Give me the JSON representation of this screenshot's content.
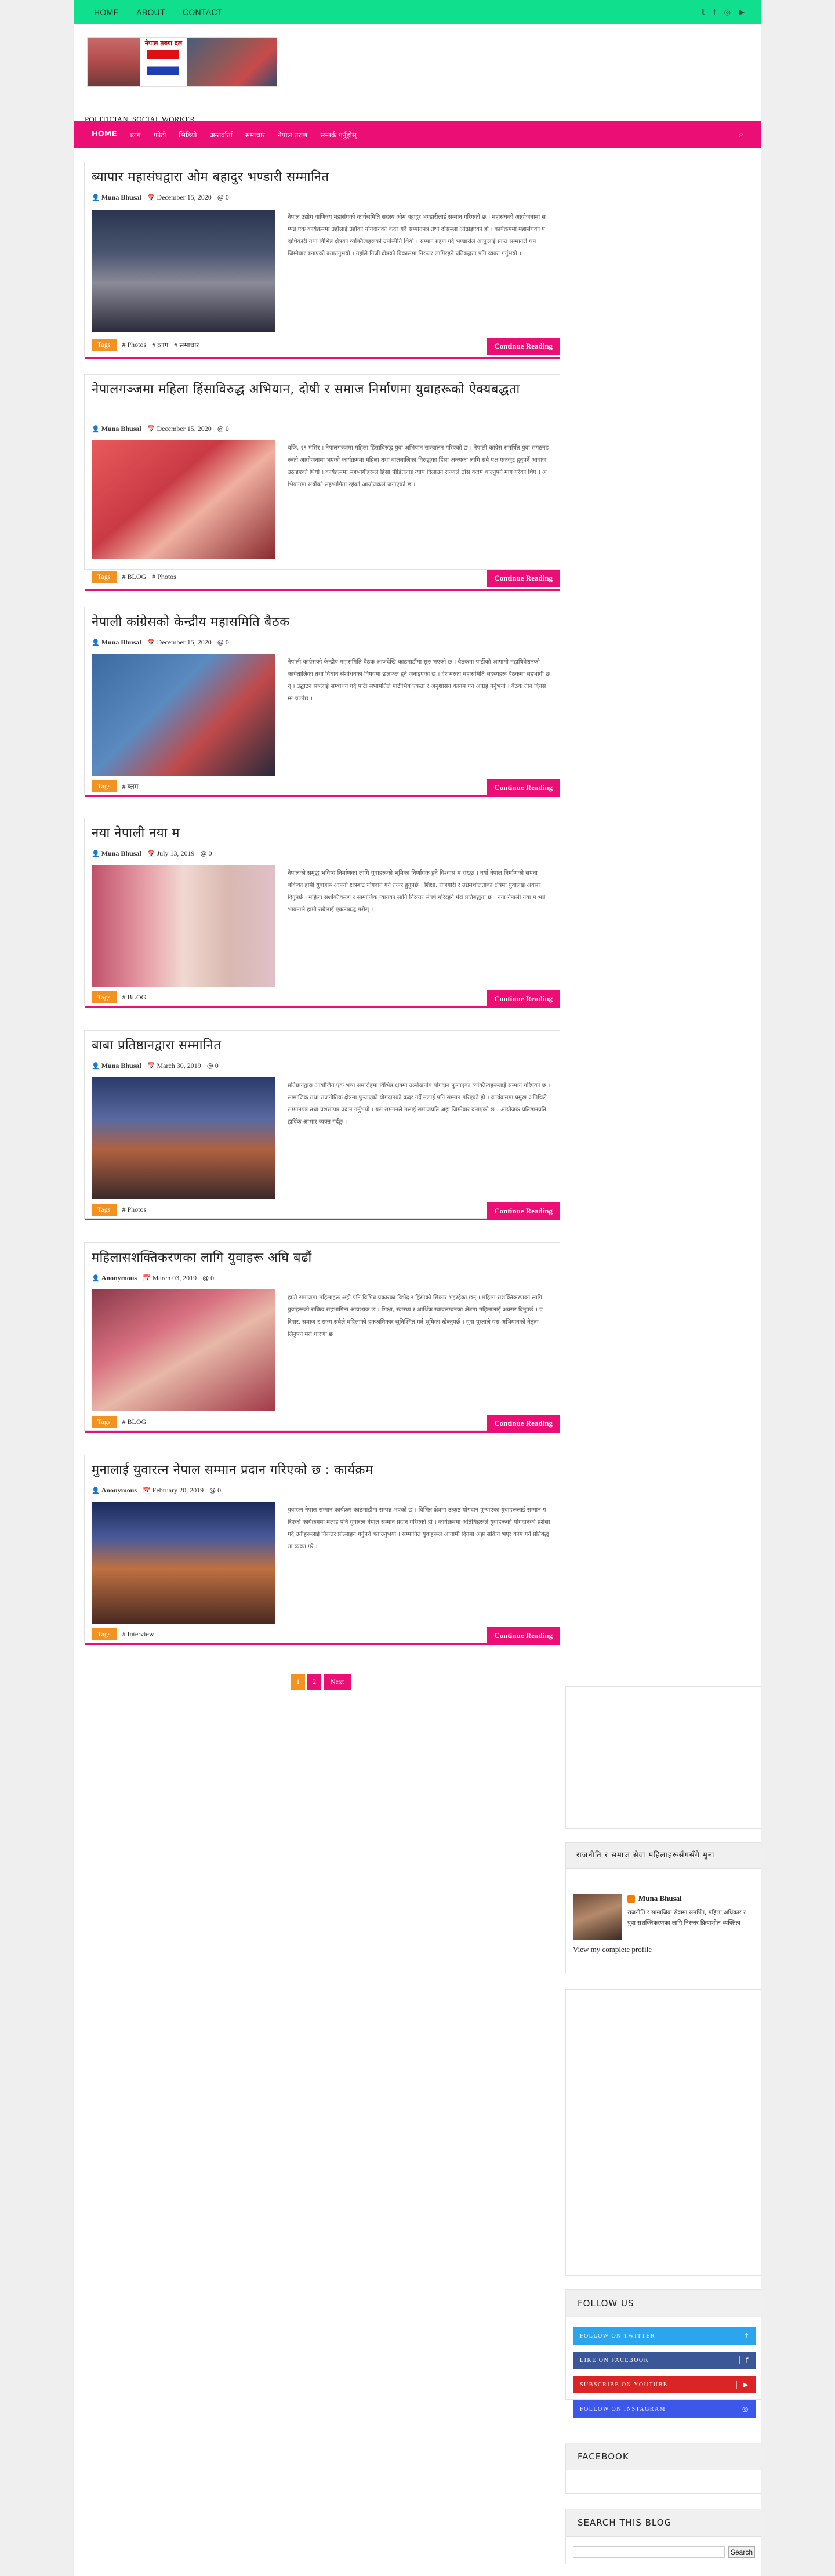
{
  "topbar": {
    "nav": [
      "HOME",
      "ABOUT",
      "CONTACT"
    ],
    "social_icons": [
      "twitter-icon",
      "facebook-icon",
      "instagram-icon",
      "youtube-icon"
    ]
  },
  "header": {
    "logo_text": "नेपाल तरुण दल",
    "tagline": "POLITICIAN, SOCIAL WORKER"
  },
  "mainnav": {
    "items": [
      "HOME",
      "ब्लग",
      "फोटो",
      "भिडियो",
      "अन्तर्वार्ता",
      "समाचार",
      "नेपाल तरुण",
      "सम्पर्क गर्नुहोस्"
    ],
    "search_icon": "search-icon"
  },
  "posts": [
    {
      "title": "ब्यापार महासंघद्वारा ओम बहादुर भण्डारी सम्मानित",
      "author": "Muna Bhusal",
      "date": "December 15, 2020",
      "comments": "0",
      "excerpt": "नेपाल उद्योग वाणिज्य महासंघको कार्यसमिति सदस्य ओम बहादुर भण्डारीलाई सम्मान गरिएको छ । महासंघको आयोजनामा सम्पन्न एक कार्यक्रममा उहाँलाई उहाँको योगदानको कदर गर्दै सम्मानपत्र तथा दोसल्ला ओढाइएको हो । कार्यक्रममा महासंघका पदाधिकारी तथा विभिन्न क्षेत्रका व्यक्तित्वहरूको उपस्थिति थियो । सम्मान ग्रहण गर्दै भण्डारीले आफूलाई प्राप्त सम्मानले थप जिम्मेवार बनाएको बताउनुभयो । उहाँले निजी क्षेत्रको विकासमा निरन्तर लागिरहने प्रतिबद्धता पनि व्यक्त गर्नुभयो ।",
      "tags": [
        "# Photos",
        "# ब्लग",
        "# समाचार"
      ]
    },
    {
      "title": "नेपालगञ्जमा महिला हिंसाविरुद्ध अभियान, दोषी र समाज निर्माणमा युवाहरूको ऐक्यबद्धता",
      "author": "Muna Bhusal",
      "date": "December 15, 2020",
      "comments": "0",
      "excerpt": "बाँके, २९ मंसिर । नेपालगञ्जमा महिला हिंसाविरुद्ध युवा अभियान सञ्चालन गरिएको छ । नेपाली कांग्रेस समर्थित युवा संगठनहरूको आयोजनामा भएको कार्यक्रममा महिला तथा बालबालिका विरुद्धका हिंसा अन्त्यका लागि सबै पक्ष एकजुट हुनुपर्ने आवाज उठाइएको थियो । कार्यक्रममा सहभागीहरूले हिंसा पीडितलाई न्याय दिलाउन राज्यले ठोस कदम चाल्नुपर्ने माग गरेका थिए । अभियानमा सयौंको सहभागिता रहेको आयोजकले जनाएको छ ।",
      "tags": [
        "# BLOG",
        "# Photos"
      ]
    },
    {
      "title": "नेपाली कांग्रेसको केन्द्रीय महासमिति बैठक",
      "author": "Muna Bhusal",
      "date": "December 15, 2020",
      "comments": "0",
      "excerpt": "नेपाली कांग्रेसको केन्द्रीय महासमिति बैठक आजदेखि काठमाडौंमा सुरु भएको छ । बैठकमा पार्टीको आगामी महाधिवेशनको कार्यतालिका तथा विधान संशोधनका विषयमा छलफल हुने जनाइएको छ । देशभरका महासमिति सदस्यहरू बैठकमा सहभागी छन् । उद्घाटन सत्रलाई सम्बोधन गर्दै पार्टी सभापतिले पार्टीभित्र एकता र अनुशासन कायम गर्न आग्रह गर्नुभयो । बैठक तीन दिनसम्म चल्नेछ ।",
      "tags": [
        "# ब्लग"
      ]
    },
    {
      "title": "नया नेपाली नया म",
      "author": "Muna Bhusal",
      "date": "July 13, 2019",
      "comments": "0",
      "excerpt": "नेपालको समृद्ध भविष्य निर्माणका लागि युवाहरूको भूमिका निर्णायक हुने विश्वास म राख्छु । नयाँ नेपाल निर्माणको सपना बोकेका हामी युवाहरू आफ्नो क्षेत्रबाट योगदान गर्न तत्पर हुनुपर्छ । शिक्षा, रोजगारी र उद्यमशीलताका क्षेत्रमा युवालाई अवसर दिनुपर्छ । महिला सशक्तिकरण र सामाजिक न्यायका लागि निरन्तर संघर्ष गरिरहने मेरो प्रतिबद्धता छ । नया नेपाली नया म भन्ने भावनाले हामी सबैलाई एकताबद्ध गरोस् ।",
      "tags": [
        "# BLOG"
      ]
    },
    {
      "title": "बाबा प्रतिष्ठानद्वारा सम्मानित",
      "author": "Muna Bhusal",
      "date": "March 30, 2019",
      "comments": "0",
      "excerpt": "प्रतिष्ठानद्वारा आयोजित एक भव्य समारोहमा विभिन्न क्षेत्रमा उल्लेखनीय योगदान पुर्‍याएका व्यक्तित्वहरूलाई सम्मान गरिएको छ । सामाजिक तथा राजनीतिक क्षेत्रमा पुर्‍याएको योगदानको कदर गर्दै मलाई पनि सम्मान गरिएको हो । कार्यक्रममा प्रमुख अतिथिले सम्मानपत्र तथा प्रशंसापत्र प्रदान गर्नुभयो । यस सम्मानले मलाई समाजप्रति अझ जिम्मेवार बनाएको छ । आयोजक प्रतिष्ठानप्रति हार्दिक आभार व्यक्त गर्दछु ।",
      "tags": [
        "# Photos"
      ]
    },
    {
      "title": "महिलासशक्तिकरणका लागि युवाहरू अघि बढौं",
      "author": "Anonymous",
      "date": "March 03, 2019",
      "comments": "0",
      "excerpt": "हाम्रो समाजमा महिलाहरू अझै पनि विभिन्न प्रकारका विभेद र हिंसाको सिकार भइरहेका छन् । महिला सशक्तिकरणका लागि युवाहरूको सक्रिय सहभागिता आवश्यक छ । शिक्षा, स्वास्थ्य र आर्थिक स्वावलम्बनका क्षेत्रमा महिलालाई अवसर दिनुपर्छ । परिवार, समाज र राज्य सबैले महिलाको हकअधिकार सुनिश्चित गर्न भूमिका खेल्नुपर्छ । युवा पुस्ताले यस अभियानको नेतृत्व लिनुपर्ने मेरो धारणा छ ।",
      "tags": [
        "# BLOG"
      ]
    },
    {
      "title": "मुनालाई युवारत्न नेपाल सम्मान प्रदान गरिएको छ : कार्यक्रम",
      "author": "Anonymous",
      "date": "February 20, 2019",
      "comments": "0",
      "excerpt": "युवारत्न नेपाल सम्मान कार्यक्रम काठमाडौंमा सम्पन्न भएको छ । विभिन्न क्षेत्रमा उत्कृष्ट योगदान पुर्‍याएका युवाहरूलाई सम्मान गरिएको कार्यक्रममा मलाई पनि युवारत्न नेपाल सम्मान प्रदान गरिएको हो । कार्यक्रममा अतिथिहरूले युवाहरूको योगदानको प्रशंसा गर्दै उनीहरूलाई निरन्तर प्रोत्साहन गर्नुपर्ने बताउनुभयो । सम्मानित युवाहरूले आगामी दिनमा अझ सक्रिय भएर काम गर्ने प्रतिबद्धता व्यक्त गरे ।",
      "tags": [
        "# Interview"
      ]
    }
  ],
  "labels": {
    "tags": "Tags",
    "continue": "Continue Reading"
  },
  "pagination": {
    "current": "1",
    "next_page": "2",
    "next": "Next"
  },
  "sidebar": {
    "profile_title": "राजनीति र समाज सेवा महिलाहरूसँगसँगै मुना",
    "profile_name": "Muna Bhusal",
    "profile_desc": "राजनीति र सामाजिक सेवामा समर्पित, महिला अधिकार र युवा सशक्तिकरणका लागि निरन्तर क्रियाशील व्यक्तित्व",
    "profile_link": "View my complete profile",
    "follow_title": "FOLLOW US",
    "follow": [
      {
        "label": "FOLLOW ON TWITTER",
        "icon": "twitter-icon",
        "color": "#2ba6ee"
      },
      {
        "label": "LIKE ON FACEBOOK",
        "icon": "facebook-icon",
        "color": "#3b5797"
      },
      {
        "label": "SUBSCRIBE ON YOUTUBE",
        "icon": "youtube-icon",
        "color": "#d92525"
      },
      {
        "label": "FOLLOW ON INSTAGRAM",
        "icon": "instagram-icon",
        "color": "#3d57e8"
      }
    ],
    "facebook_title": "FACEBOOK",
    "search_title": "SEARCH THIS BLOG",
    "search_button": "Search"
  },
  "colors": {
    "topbar": "#10e08d",
    "accent": "#eb0f75",
    "tag_label": "#f4921f"
  }
}
